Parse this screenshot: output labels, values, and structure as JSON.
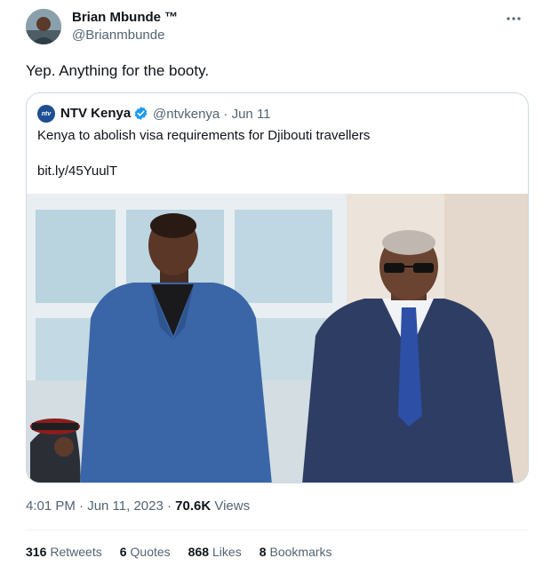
{
  "tweet": {
    "author": {
      "name": "Brian Mbunde ™",
      "handle": "@Brianmbunde"
    },
    "text": "Yep. Anything for the booty.",
    "more_icon": "more-horizontal-icon",
    "quoted": {
      "avatar_text": "ntv",
      "name": "NTV Kenya",
      "verified_icon": "verified-badge-icon",
      "meta": "@ntvkenya · Jun 11",
      "text": "Kenya to abolish visa requirements for Djibouti travellers",
      "link": "bit.ly/45YuulT"
    },
    "timestamp": "4:01 PM · Jun 11, 2023 · ",
    "views_count": "70.6K",
    "views_label": "Views",
    "stats": [
      {
        "count": "316",
        "label": "Retweets"
      },
      {
        "count": "6",
        "label": "Quotes"
      },
      {
        "count": "868",
        "label": "Likes"
      },
      {
        "count": "8",
        "label": "Bookmarks"
      }
    ]
  },
  "colors": {
    "text_primary": "#0f1419",
    "text_secondary": "#536471",
    "border": "#cfd9de",
    "verified_blue": "#1d9bf0"
  }
}
